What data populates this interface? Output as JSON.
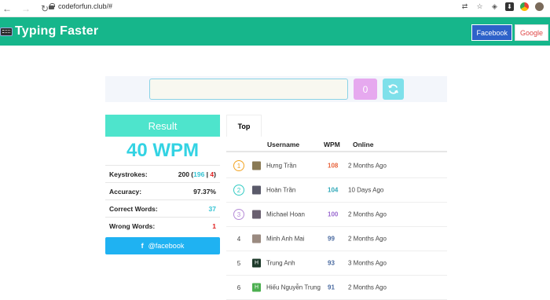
{
  "browser": {
    "url": "codeforfun.club/#"
  },
  "header": {
    "brand": "Typing Faster",
    "facebook_label": "Facebook",
    "google_label": "Google",
    "bg_color": "#16b68b"
  },
  "typing": {
    "input_value": "",
    "counter": "0"
  },
  "result": {
    "title": "Result",
    "wpm": "40 WPM",
    "keystrokes_label": "Keystrokes:",
    "keystrokes_total": "200",
    "keystrokes_correct": "196",
    "keystrokes_wrong": "4",
    "accuracy_label": "Accuracy:",
    "accuracy_value": "97.37%",
    "correct_label": "Correct Words:",
    "correct_value": "37",
    "wrong_label": "Wrong Words:",
    "wrong_value": "1",
    "share_label": "@facebook"
  },
  "leaderboard": {
    "tab": "Top",
    "columns": [
      "Username",
      "WPM",
      "Online"
    ],
    "rows": [
      {
        "rank": "1",
        "username": "Hưng Trần",
        "wpm": "108",
        "online": "2 Months Ago",
        "rank_color": "#f2a321",
        "wpm_color": "#e8643c",
        "avatar_color": "#8a7a55",
        "avatar_letter": ""
      },
      {
        "rank": "2",
        "username": "Hoàn Trần",
        "wpm": "104",
        "online": "10 Days Ago",
        "rank_color": "#33cbc4",
        "wpm_color": "#2fa8b8",
        "avatar_color": "#5a5a6a",
        "avatar_letter": ""
      },
      {
        "rank": "3",
        "username": "Michael Hoan",
        "wpm": "100",
        "online": "2 Months Ago",
        "rank_color": "#b58ad6",
        "wpm_color": "#9b6ad0",
        "avatar_color": "#6a6070",
        "avatar_letter": ""
      },
      {
        "rank": "4",
        "username": "Minh Anh Mai",
        "wpm": "99",
        "online": "2 Months Ago",
        "rank_color": "",
        "wpm_color": "#4a6aa0",
        "avatar_color": "#9a8a80",
        "avatar_letter": ""
      },
      {
        "rank": "5",
        "username": "Trung Anh",
        "wpm": "93",
        "online": "3 Months Ago",
        "rank_color": "",
        "wpm_color": "#4a6aa0",
        "avatar_color": "#1d3a2a",
        "avatar_letter": "H"
      },
      {
        "rank": "6",
        "username": "Hiếu Nguyễn Trung",
        "wpm": "91",
        "online": "2 Months Ago",
        "rank_color": "",
        "wpm_color": "#4a6aa0",
        "avatar_color": "#4caf50",
        "avatar_letter": "H"
      }
    ]
  }
}
